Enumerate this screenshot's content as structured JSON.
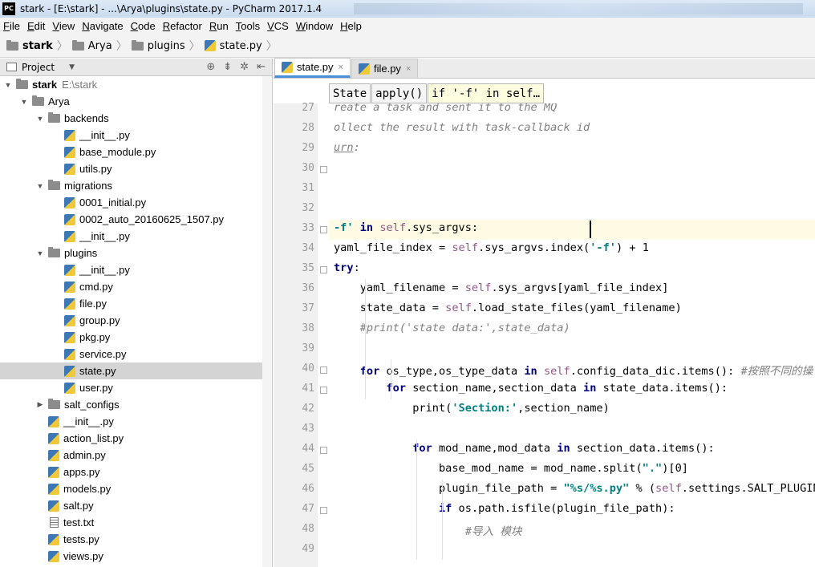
{
  "window": {
    "title": "stark - [E:\\stark] - ...\\Arya\\plugins\\state.py - PyCharm 2017.1.4",
    "logo": "PC"
  },
  "menu": [
    "File",
    "Edit",
    "View",
    "Navigate",
    "Code",
    "Refactor",
    "Run",
    "Tools",
    "VCS",
    "Window",
    "Help"
  ],
  "navbar": {
    "crumbs": [
      "stark",
      "Arya",
      "plugins",
      "state.py"
    ]
  },
  "project": {
    "header": "Project",
    "tools": [
      "⊕",
      "⇟",
      "✲",
      "⇤"
    ],
    "tree": [
      {
        "label": "stark",
        "path": "E:\\stark",
        "depth": 0,
        "kind": "folder",
        "expanded": true,
        "bold": true
      },
      {
        "label": "Arya",
        "depth": 1,
        "kind": "folder",
        "expanded": true
      },
      {
        "label": "backends",
        "depth": 2,
        "kind": "folder",
        "expanded": true
      },
      {
        "label": "__init__.py",
        "depth": 3,
        "kind": "py"
      },
      {
        "label": "base_module.py",
        "depth": 3,
        "kind": "py"
      },
      {
        "label": "utils.py",
        "depth": 3,
        "kind": "py"
      },
      {
        "label": "migrations",
        "depth": 2,
        "kind": "folder",
        "expanded": true
      },
      {
        "label": "0001_initial.py",
        "depth": 3,
        "kind": "py"
      },
      {
        "label": "0002_auto_20160625_1507.py",
        "depth": 3,
        "kind": "py"
      },
      {
        "label": "__init__.py",
        "depth": 3,
        "kind": "py"
      },
      {
        "label": "plugins",
        "depth": 2,
        "kind": "folder",
        "expanded": true
      },
      {
        "label": "__init__.py",
        "depth": 3,
        "kind": "py"
      },
      {
        "label": "cmd.py",
        "depth": 3,
        "kind": "py"
      },
      {
        "label": "file.py",
        "depth": 3,
        "kind": "py"
      },
      {
        "label": "group.py",
        "depth": 3,
        "kind": "py"
      },
      {
        "label": "pkg.py",
        "depth": 3,
        "kind": "py"
      },
      {
        "label": "service.py",
        "depth": 3,
        "kind": "py"
      },
      {
        "label": "state.py",
        "depth": 3,
        "kind": "py",
        "selected": true
      },
      {
        "label": "user.py",
        "depth": 3,
        "kind": "py"
      },
      {
        "label": "salt_configs",
        "depth": 2,
        "kind": "folder",
        "expanded": false
      },
      {
        "label": "__init__.py",
        "depth": 2,
        "kind": "py"
      },
      {
        "label": "action_list.py",
        "depth": 2,
        "kind": "py"
      },
      {
        "label": "admin.py",
        "depth": 2,
        "kind": "py"
      },
      {
        "label": "apps.py",
        "depth": 2,
        "kind": "py"
      },
      {
        "label": "models.py",
        "depth": 2,
        "kind": "py"
      },
      {
        "label": "salt.py",
        "depth": 2,
        "kind": "py"
      },
      {
        "label": "test.txt",
        "depth": 2,
        "kind": "txt"
      },
      {
        "label": "tests.py",
        "depth": 2,
        "kind": "py"
      },
      {
        "label": "views.py",
        "depth": 2,
        "kind": "py"
      }
    ]
  },
  "editor": {
    "tabs": [
      {
        "label": "state.py",
        "active": true
      },
      {
        "label": "file.py",
        "active": false
      }
    ],
    "code_crumbs": [
      "State",
      "apply()",
      "if '-f' in self…"
    ],
    "lines": [
      {
        "n": "27",
        "html": "<span class='cmt'>reate a task and sent it to the MQ</span>"
      },
      {
        "n": "28",
        "html": "<span class='cmt'>ollect the result with task-callback id</span>"
      },
      {
        "n": "29",
        "html": "<span class='cmt'><u>urn</u>:</span>"
      },
      {
        "n": "30",
        "html": ""
      },
      {
        "n": "31",
        "html": ""
      },
      {
        "n": "32",
        "html": ""
      },
      {
        "n": "33",
        "html": "<span class='str'>-f'</span> <span class='kw'>in</span> <span class='self'>self</span>.sys_argvs:"
      },
      {
        "n": "34",
        "html": "yaml_file_index = <span class='self'>self</span>.sys_argvs.index(<span class='str'>'-f'</span>) + 1"
      },
      {
        "n": "35",
        "html": "<span class='kw'>try</span>:"
      },
      {
        "n": "36",
        "html": "    yaml_filename = <span class='self'>self</span>.sys_argvs[yaml_file_index]"
      },
      {
        "n": "37",
        "html": "    state_data = <span class='self'>self</span>.load_state_files(yaml_filename)"
      },
      {
        "n": "38",
        "html": "    <span class='cmt'>#print('state data:',state_data)</span>"
      },
      {
        "n": "39",
        "html": ""
      },
      {
        "n": "40",
        "html": "    <span class='kw'>for</span> os_type,os_type_data <span class='kw'>in</span> <span class='self'>self</span>.config_data_dic.items(): <span class='cmt'>#按照不同的操</span>"
      },
      {
        "n": "41",
        "html": "        <span class='kw'>for</span> section_name,section_data <span class='kw'>in</span> state_data.items():"
      },
      {
        "n": "42",
        "html": "            print(<span class='str'>'Section:'</span>,section_name)"
      },
      {
        "n": "43",
        "html": ""
      },
      {
        "n": "44",
        "html": "            <span class='kw'>for</span> mod_name,mod_data <span class='kw'>in</span> section_data.items():"
      },
      {
        "n": "45",
        "html": "                base_mod_name = mod_name.split(<span class='str'>\".\"</span>)[0]"
      },
      {
        "n": "46",
        "html": "                plugin_file_path = <span class='str'>\"%s/%s.py\"</span> % (<span class='self'>self</span>.settings.SALT_PLUGIN"
      },
      {
        "n": "47",
        "html": "                <span class='kw'>if</span> os.path.isfile(plugin_file_path):"
      },
      {
        "n": "48",
        "html": "                    <span class='cmt'>#导入 模块</span>"
      },
      {
        "n": "49",
        "html": ""
      }
    ]
  }
}
